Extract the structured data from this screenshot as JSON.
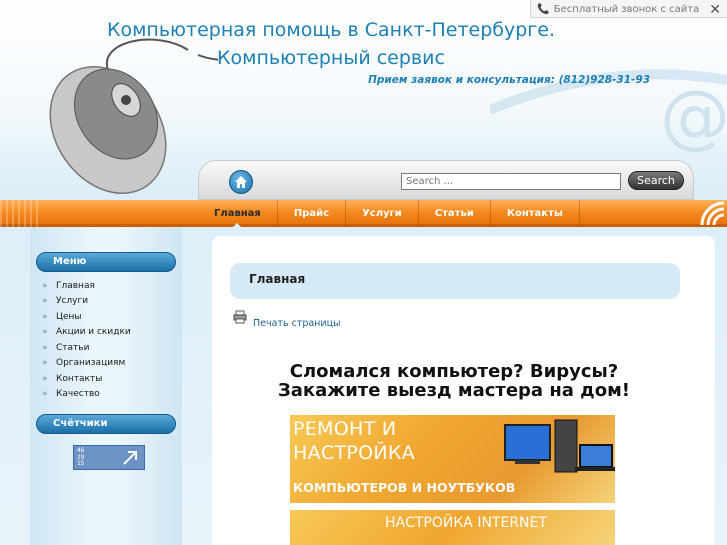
{
  "callback": {
    "label": "Бесплатный звонок с сайта",
    "close": "✕"
  },
  "header": {
    "title": "Компьютерная помощь в Санкт-Петербурге. Компьютерный сервис",
    "contact": "Прием заявок и консультация: (812)928-31-93"
  },
  "search": {
    "placeholder": "Search ...",
    "button_label": "Search"
  },
  "nav": {
    "items": [
      {
        "label": "Главная",
        "active": true
      },
      {
        "label": "Прайс"
      },
      {
        "label": "Услуги"
      },
      {
        "label": "Статьи"
      },
      {
        "label": "Контакты"
      }
    ]
  },
  "sidebar": {
    "menu_title": "Меню",
    "menu_items": [
      {
        "label": "Главная"
      },
      {
        "label": "Услуги"
      },
      {
        "label": "Цены"
      },
      {
        "label": "Акции и скидки"
      },
      {
        "label": "Статьи"
      },
      {
        "label": "Организациям"
      },
      {
        "label": "Контакты"
      },
      {
        "label": "Качество"
      }
    ],
    "counters_title": "Счётчики",
    "counter_digits": [
      "46",
      "29",
      "15"
    ]
  },
  "main": {
    "page_heading": "Главная",
    "print_link": "Печать страницы",
    "headline_1": "Сломался компьютер? Вирусы?",
    "headline_2": "Закажите выезд мастера на дом!",
    "banner1": {
      "line1": "РЕМОНТ И",
      "line2": "НАСТРОЙКА",
      "line3": "КОМПЬЮТЕРОВ И НОУТБУКОВ"
    },
    "banner2": {
      "label": "НАСТРОЙКА INTERNET"
    }
  },
  "colors": {
    "accent": "#1e7fb2",
    "nav_orange": "#f58a1f",
    "sidebar_head": "#1a6fa8"
  }
}
